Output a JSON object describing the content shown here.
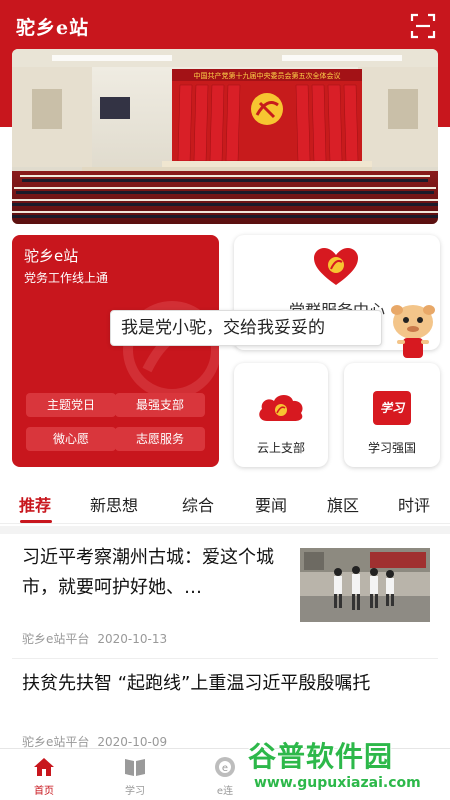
{
  "header": {
    "title": "驼乡e站",
    "scan_icon": "scan-icon"
  },
  "banner": {
    "headline": "中国共产党第十九届中央委员会第五次全体会议",
    "colors": {
      "stage_red": "#c71b1c",
      "curtain": "#d91f27"
    }
  },
  "left_card": {
    "title": "驼乡e站",
    "subtitle": "党务工作线上通",
    "pills": [
      "主题党日",
      "最强支部",
      "微心愿",
      "志愿服务"
    ]
  },
  "service_card": {
    "label": "党群服务中心",
    "icon": "heart-hands-icon"
  },
  "speech_bubble": {
    "text": "我是党小驼，交给我妥妥的"
  },
  "small_cards": [
    {
      "label": "云上支部",
      "icon": "party-cloud-icon"
    },
    {
      "label": "学习强国",
      "icon": "xuexi-icon",
      "icon_text": "学习"
    }
  ],
  "tabs": {
    "items": [
      "推荐",
      "新思想",
      "综合",
      "要闻",
      "旗区",
      "时评"
    ],
    "active_index": 0
  },
  "news": [
    {
      "title": "习近平考察潮州古城：爱这个城市，就要呵护好她、…",
      "source": "驼乡e站平台",
      "date": "2020-10-13"
    },
    {
      "title": "扶贫先扶智 “起跑线”上重温习近平殷殷嘱托",
      "source": "驼乡e站平台",
      "date": "2020-10-09"
    }
  ],
  "bottom_nav": [
    {
      "label": "首页",
      "icon": "home-icon",
      "active": true
    },
    {
      "label": "学习",
      "icon": "book-icon",
      "active": false
    },
    {
      "label": "e连",
      "icon": "e-link-icon",
      "active": false
    }
  ],
  "watermark": {
    "brand": "谷普软件园",
    "url": "www.gupuxiazai.com"
  },
  "colors": {
    "primary": "#c8161d",
    "pill": "#d9363c",
    "meta": "#999999",
    "watermark": "#2db84a"
  }
}
